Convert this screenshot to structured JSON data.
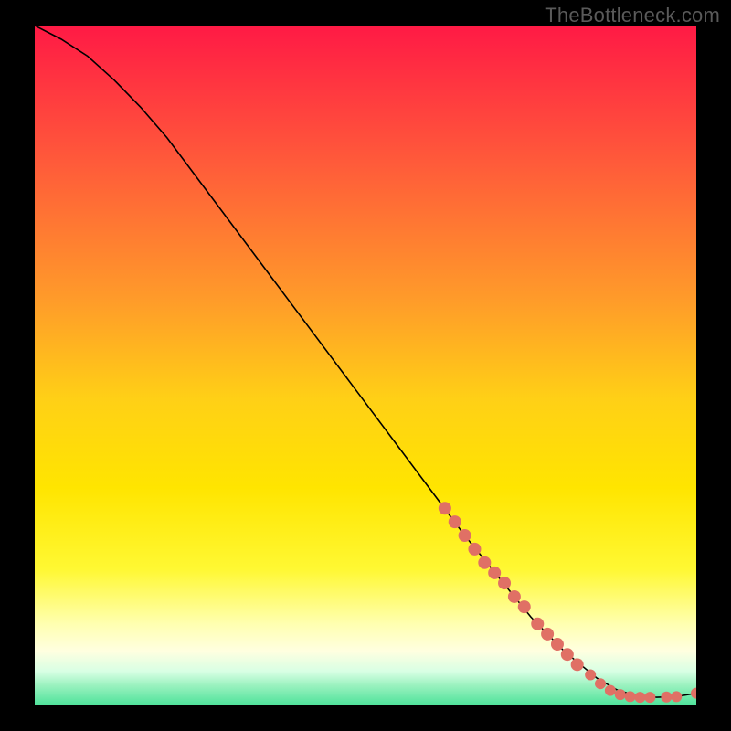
{
  "watermark": "TheBottleneck.com",
  "chart_data": {
    "type": "line",
    "title": "",
    "xlabel": "",
    "ylabel": "",
    "xlim": [
      0,
      100
    ],
    "ylim": [
      0,
      100
    ],
    "grid": false,
    "legend": false,
    "background_gradient": {
      "stops": [
        {
          "offset": 0.0,
          "color": "#ff1a45"
        },
        {
          "offset": 0.2,
          "color": "#ff5a3a"
        },
        {
          "offset": 0.4,
          "color": "#ff9a2a"
        },
        {
          "offset": 0.55,
          "color": "#ffd016"
        },
        {
          "offset": 0.68,
          "color": "#ffe500"
        },
        {
          "offset": 0.8,
          "color": "#fff833"
        },
        {
          "offset": 0.88,
          "color": "#ffffb0"
        },
        {
          "offset": 0.92,
          "color": "#ffffe0"
        },
        {
          "offset": 0.95,
          "color": "#d8ffe4"
        },
        {
          "offset": 0.97,
          "color": "#9cf2c0"
        },
        {
          "offset": 1.0,
          "color": "#4de29a"
        }
      ]
    },
    "series": [
      {
        "name": "curve",
        "type": "line",
        "color": "#000000",
        "x": [
          0,
          4,
          8,
          12,
          16,
          20,
          25,
          30,
          35,
          40,
          45,
          50,
          55,
          60,
          65,
          70,
          75,
          80,
          85,
          88,
          91,
          94,
          97,
          100
        ],
        "y": [
          100,
          98,
          95.5,
          92,
          88,
          83.5,
          77,
          70.5,
          64,
          57.5,
          51,
          44.5,
          38,
          31.5,
          25,
          19,
          13,
          8,
          4,
          2.3,
          1.4,
          1.2,
          1.3,
          1.8
        ]
      },
      {
        "name": "markers",
        "type": "scatter",
        "color": "#e07065",
        "radius_large": 7,
        "radius_small": 6,
        "points": [
          {
            "x": 62,
            "y": 29,
            "r": "large"
          },
          {
            "x": 63.5,
            "y": 27,
            "r": "large"
          },
          {
            "x": 65,
            "y": 25,
            "r": "large"
          },
          {
            "x": 66.5,
            "y": 23,
            "r": "large"
          },
          {
            "x": 68,
            "y": 21,
            "r": "large"
          },
          {
            "x": 69.5,
            "y": 19.5,
            "r": "large"
          },
          {
            "x": 71,
            "y": 18,
            "r": "large"
          },
          {
            "x": 72.5,
            "y": 16,
            "r": "large"
          },
          {
            "x": 74,
            "y": 14.5,
            "r": "large"
          },
          {
            "x": 76,
            "y": 12,
            "r": "large"
          },
          {
            "x": 77.5,
            "y": 10.5,
            "r": "large"
          },
          {
            "x": 79,
            "y": 9,
            "r": "large"
          },
          {
            "x": 80.5,
            "y": 7.5,
            "r": "large"
          },
          {
            "x": 82,
            "y": 6,
            "r": "large"
          },
          {
            "x": 84,
            "y": 4.5,
            "r": "small"
          },
          {
            "x": 85.5,
            "y": 3.2,
            "r": "small"
          },
          {
            "x": 87,
            "y": 2.2,
            "r": "small"
          },
          {
            "x": 88.5,
            "y": 1.6,
            "r": "small"
          },
          {
            "x": 90,
            "y": 1.3,
            "r": "small"
          },
          {
            "x": 91.5,
            "y": 1.2,
            "r": "small"
          },
          {
            "x": 93,
            "y": 1.2,
            "r": "small"
          },
          {
            "x": 95.5,
            "y": 1.25,
            "r": "small"
          },
          {
            "x": 97,
            "y": 1.3,
            "r": "small"
          },
          {
            "x": 100,
            "y": 1.8,
            "r": "small"
          }
        ]
      }
    ]
  }
}
